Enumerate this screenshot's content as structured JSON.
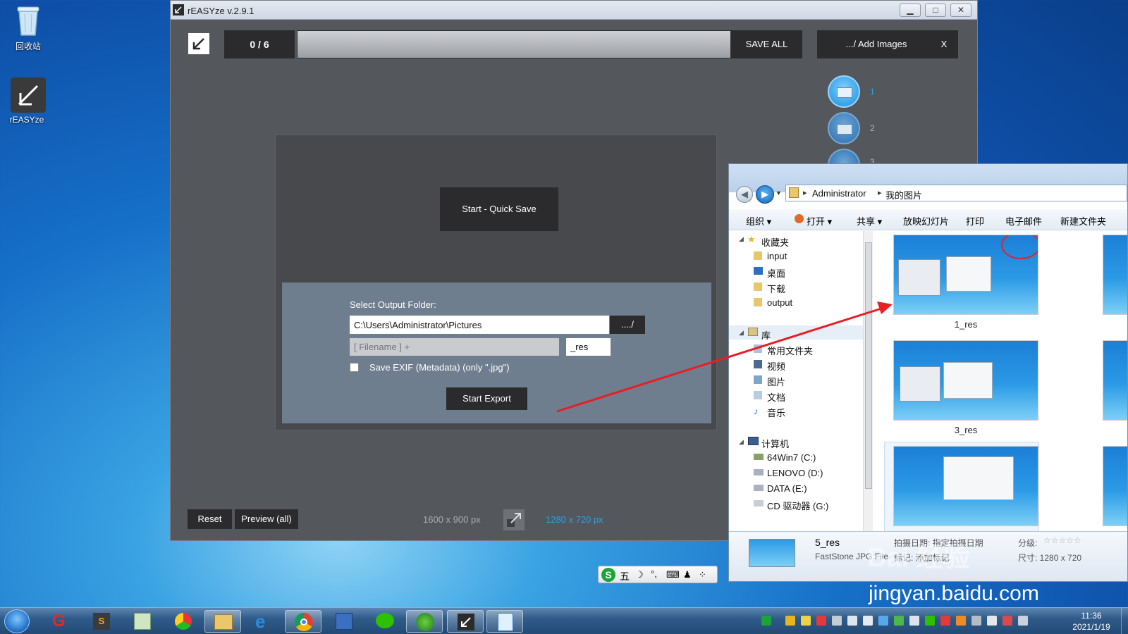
{
  "desktop": {
    "icons": [
      {
        "label": "回收站",
        "icon": "recycle-bin-icon"
      },
      {
        "label": "rEASYze",
        "icon": "reasyze-app-icon"
      }
    ]
  },
  "app": {
    "title": "rEASYze v.2.9.1",
    "counter": "0 / 6",
    "save_all": "SAVE ALL",
    "add_images": ".../ Add Images",
    "close_x": "X",
    "image_list": [
      {
        "num": "1"
      },
      {
        "num": "2"
      },
      {
        "num": "3"
      }
    ],
    "quick_save": "Start - Quick Save",
    "output_folder_label": "Select Output Folder:",
    "output_path": "C:\\Users\\Administrator\\Pictures",
    "browse": "..../",
    "filename_placeholder": "[ Filename ] +",
    "suffix": "_res",
    "exif_label": "Save EXIF (Metadata) (only \".jpg\")",
    "start_export": "Start Export",
    "reset": "Reset",
    "preview_all": "Preview (all)",
    "source_size": "1600 x 900 px",
    "target_size": "1280 x 720 px",
    "accent_color": "#2aa0e8"
  },
  "explorer": {
    "breadcrumb": [
      "Administrator",
      "我的图片"
    ],
    "toolbar": [
      "组织 ▾",
      "打开 ▾",
      "共享 ▾",
      "放映幻灯片",
      "打印",
      "电子邮件",
      "新建文件夹"
    ],
    "favorites_header": "收藏夹",
    "favorites": [
      "input",
      "桌面",
      "下载",
      "output"
    ],
    "libraries_header": "库",
    "libraries": [
      "常用文件夹",
      "视频",
      "图片",
      "文档",
      "音乐"
    ],
    "computer_header": "计算机",
    "drives": [
      "64Win7 (C:)",
      "LENOVO (D:)",
      "DATA (E:)",
      "CD 驱动器 (G:)"
    ],
    "files": [
      {
        "name": "1_res"
      },
      {
        "name": "3_res"
      },
      {
        "name": "5_res"
      }
    ],
    "details": {
      "name": "5_res",
      "type": "FastStone JPG File",
      "date_taken": "拍摄日期: 指定拍摄日期",
      "tags": "标记: 添加标记",
      "rating": "分级:",
      "dimensions": "尺寸: 1280 x 720"
    }
  },
  "ime": {
    "mode": "五"
  },
  "watermark": {
    "text": "Bai 经验",
    "url": "jingyan.baidu.com"
  },
  "clock": {
    "time": "11:36",
    "date": "2021/1/19"
  }
}
